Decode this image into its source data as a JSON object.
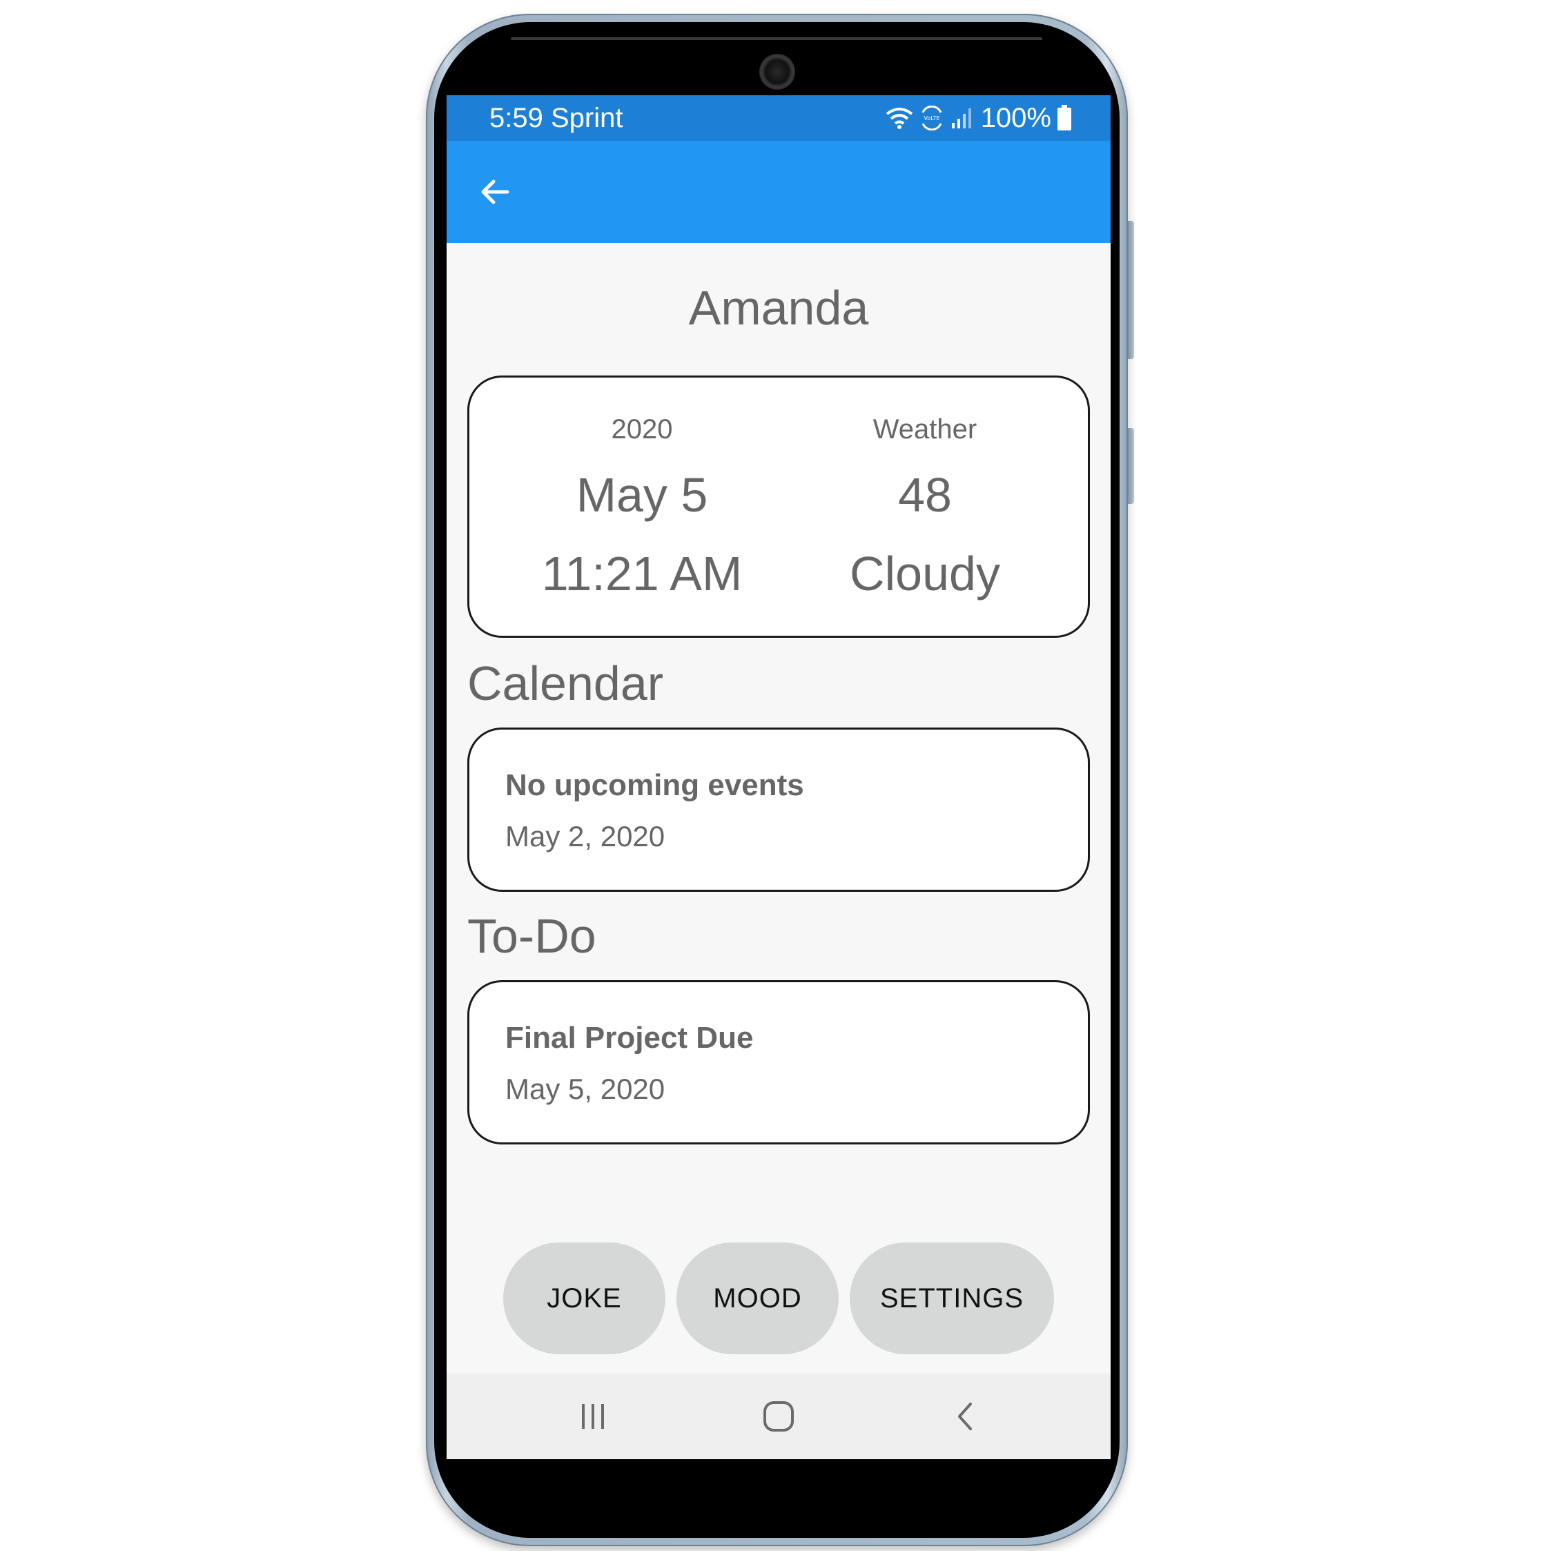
{
  "status_bar": {
    "time_carrier": "5:59 Sprint",
    "battery": "100%",
    "icons": [
      "wifi-icon",
      "volte-icon",
      "signal-icon",
      "battery-icon"
    ]
  },
  "app_bar": {
    "back_icon": "arrow-left-icon",
    "color": "#2196f3"
  },
  "user": {
    "name": "Amanda"
  },
  "info_card": {
    "year": "2020",
    "date": "May 5",
    "time": "11:21 AM",
    "weather_label": "Weather",
    "temperature": "48",
    "condition": "Cloudy"
  },
  "calendar": {
    "title": "Calendar",
    "event_title": "No upcoming events",
    "event_date": "May 2, 2020"
  },
  "todo": {
    "title": "To-Do",
    "item_title": "Final Project Due",
    "item_date": "May 5, 2020"
  },
  "buttons": {
    "joke": "JOKE",
    "mood": "MOOD",
    "settings": "SETTINGS"
  },
  "nav_bar": {
    "icons": [
      "recents-icon",
      "home-icon",
      "back-icon"
    ]
  },
  "colors": {
    "status_bar": "#1e7fd6",
    "app_bar": "#2196f3",
    "pill": "#d6d8d7",
    "text_gray": "#666666"
  }
}
